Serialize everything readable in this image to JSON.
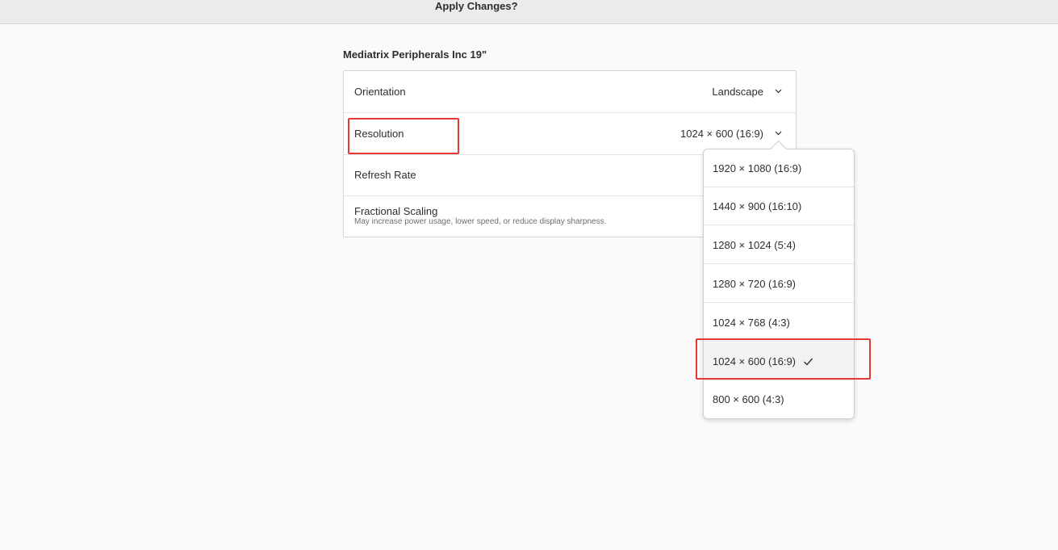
{
  "header": {
    "title": "Apply Changes?"
  },
  "display": {
    "name": "Mediatrix Peripherals Inc 19\"",
    "rows": [
      {
        "label": "Orientation",
        "value": "Landscape"
      },
      {
        "label": "Resolution",
        "value": "1024 × 600 (16:9)"
      },
      {
        "label": "Refresh Rate"
      },
      {
        "label": "Fractional Scaling",
        "sublabel": "May increase power usage, lower speed, or reduce display sharpness."
      }
    ]
  },
  "resolution_menu": {
    "options": [
      {
        "label": "1920 × 1080 (16:9)"
      },
      {
        "label": "1440 × 900 (16:10)"
      },
      {
        "label": "1280 × 1024 (5:4)"
      },
      {
        "label": "1280 × 720 (16:9)"
      },
      {
        "label": "1024 × 768 (4:3)"
      },
      {
        "label": "1024 × 600 (16:9)",
        "selected": true
      },
      {
        "label": "800 × 600 (4:3)"
      }
    ]
  },
  "colors": {
    "annotation_red": "#e53935",
    "header_bg": "#ebebeb",
    "page_bg": "#fafafa"
  }
}
